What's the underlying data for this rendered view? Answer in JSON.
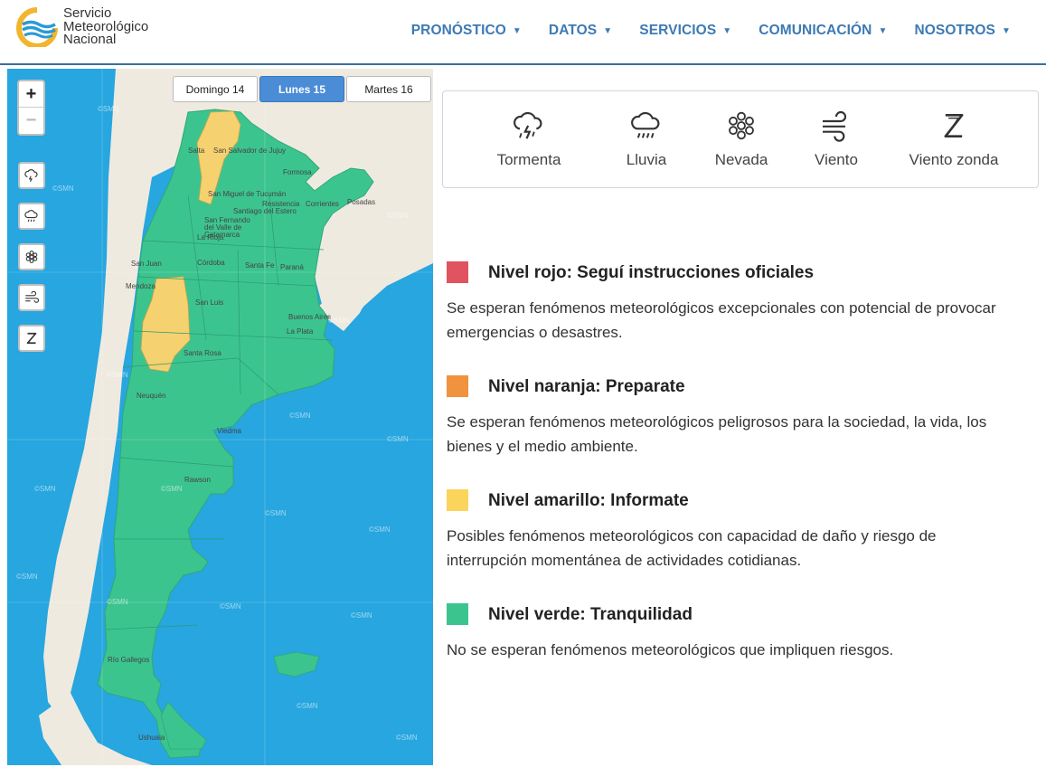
{
  "logo": {
    "line1": "Servicio",
    "line2": "Meteorológico",
    "line3": "Nacional"
  },
  "nav": [
    {
      "label": "PRONÓSTICO"
    },
    {
      "label": "DATOS"
    },
    {
      "label": "SERVICIOS"
    },
    {
      "label": "COMUNICACIÓN"
    },
    {
      "label": "NOSOTROS"
    }
  ],
  "map": {
    "zoom_in": "+",
    "zoom_out": "−",
    "days": [
      {
        "label": "Domingo 14",
        "active": false
      },
      {
        "label": "Lunes 15",
        "active": true
      },
      {
        "label": "Martes 16",
        "active": false
      }
    ],
    "layer_buttons": [
      "storm-icon",
      "rain-icon",
      "snow-icon",
      "wind-icon",
      "zonda-icon"
    ],
    "cities": [
      "Salta",
      "San Salvador de Jujuy",
      "Formosa",
      "San Miguel de Tucumán",
      "Resistencia",
      "Corrientes",
      "Posadas",
      "Santiago del Estero",
      "San Fernando del Valle de Catamarca",
      "La Rioja",
      "Córdoba",
      "San Juan",
      "Santa Fe",
      "Paraná",
      "Mendoza",
      "San Luis",
      "Buenos Aires",
      "La Plata",
      "Santa Rosa",
      "Neuquén",
      "Viedma",
      "Rawson",
      "Río Gallegos",
      "Ushuaia"
    ],
    "watermark": "©SMN",
    "colors": {
      "sea": "#27a6df",
      "land": "#efeae0",
      "green": "#3cc48f",
      "yellow": "#f5d170"
    }
  },
  "phenomena": [
    {
      "label": "Tormenta",
      "icon": "storm-icon"
    },
    {
      "label": "Lluvia",
      "icon": "rain-icon"
    },
    {
      "label": "Nevada",
      "icon": "snow-icon"
    },
    {
      "label": "Viento",
      "icon": "wind-icon"
    },
    {
      "label": "Viento zonda",
      "icon": "zonda-icon"
    }
  ],
  "levels": [
    {
      "color": "#e05361",
      "title": "Nivel rojo: Seguí instrucciones oficiales",
      "description": "Se esperan fenómenos meteorológicos excepcionales con potencial de provocar emergencias o desastres."
    },
    {
      "color": "#f0923e",
      "title": "Nivel naranja: Preparate",
      "description": "Se esperan fenómenos meteorológicos peligrosos para la sociedad, la vida, los bienes y el medio ambiente."
    },
    {
      "color": "#fbd45c",
      "title": "Nivel amarillo: Informate",
      "description": "Posibles fenómenos meteorológicos con capacidad de daño y riesgo de interrupción momentánea de actividades cotidianas."
    },
    {
      "color": "#3cc48f",
      "title": "Nivel verde: Tranquilidad",
      "description": "No se esperan fenómenos meteorológicos que impliquen riesgos."
    }
  ]
}
